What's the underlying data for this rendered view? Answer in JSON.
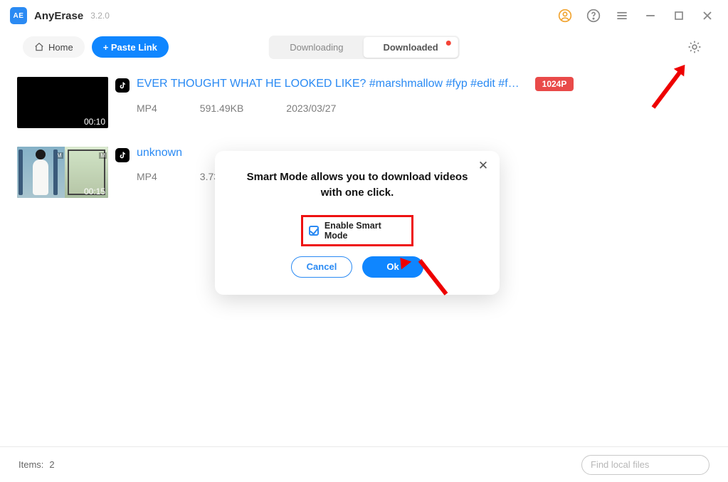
{
  "title_bar": {
    "app_name": "AnyErase",
    "version": "3.2.0",
    "logo_text": "AE"
  },
  "sub_bar": {
    "home_label": "Home",
    "paste_label": "+ Paste Link",
    "downloading_label": "Downloading",
    "downloaded_label": "Downloaded"
  },
  "items": [
    {
      "duration": "00:10",
      "title": "EVER THOUGHT WHAT HE LOOKED LIKE? #marshmallow #fyp #edit #f…",
      "quality": "1024P",
      "format": "MP4",
      "size": "591.49KB",
      "date": "2023/03/27"
    },
    {
      "duration": "00:15",
      "title": "unknown",
      "format": "MP4",
      "size": "3.73"
    }
  ],
  "dialog": {
    "message_l1": "Smart Mode allows you to download videos",
    "message_l2": "with one click.",
    "enable_label": "Enable Smart Mode",
    "cancel": "Cancel",
    "ok": "Ok"
  },
  "footer": {
    "items_label": "Items:",
    "items_count": "2",
    "search_placeholder": "Find local files"
  }
}
